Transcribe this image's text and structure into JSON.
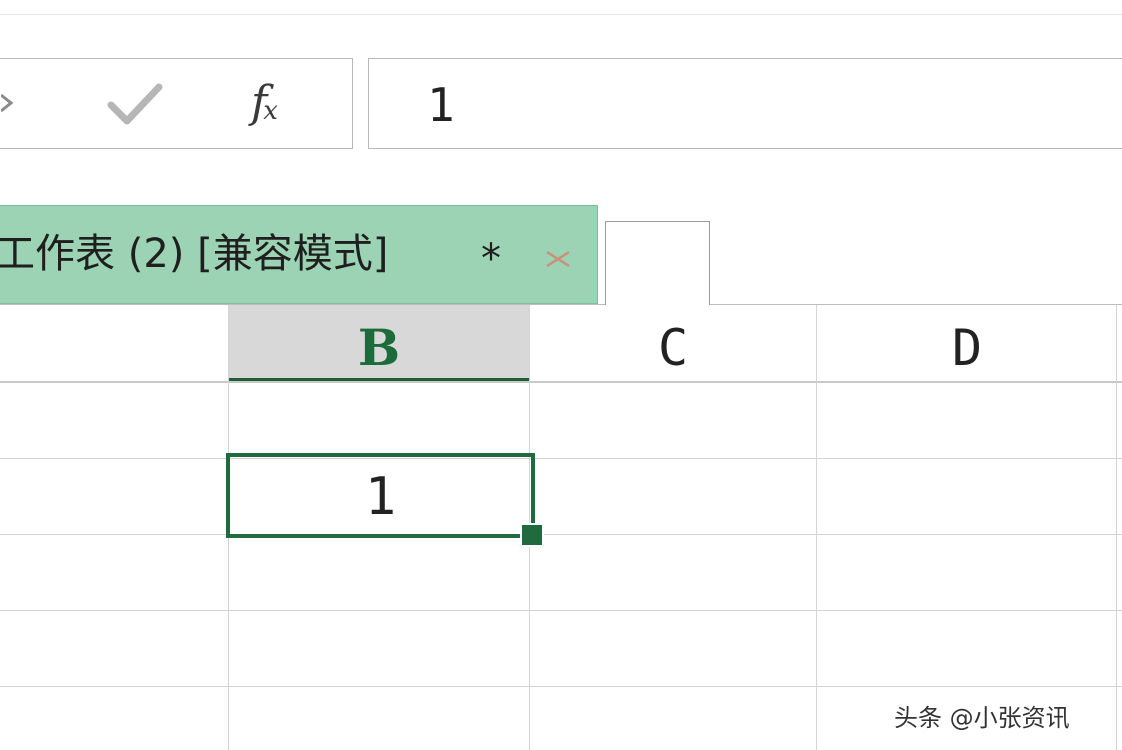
{
  "formula_bar": {
    "cancel_icon": "close-icon",
    "enter_icon": "checkmark-icon",
    "function_icon": "fx-icon",
    "fx_label": "f",
    "fx_sub": "x",
    "value": "1"
  },
  "document_tab": {
    "title": "工作表 (2) [兼容模式]",
    "modified_marker": "*",
    "close_icon": "close-icon",
    "color": "#9bd3b4"
  },
  "columns": [
    {
      "label": "",
      "selected": false
    },
    {
      "label": "B",
      "selected": true
    },
    {
      "label": "C",
      "selected": false
    },
    {
      "label": "D",
      "selected": false
    }
  ],
  "active_cell": {
    "column": "B",
    "value": "1"
  },
  "watermark": "头条 @小张资讯",
  "colors": {
    "accent": "#1f6b3d",
    "tab_bg": "#9bd3b4",
    "selected_header_bg": "#d8d8d8"
  }
}
